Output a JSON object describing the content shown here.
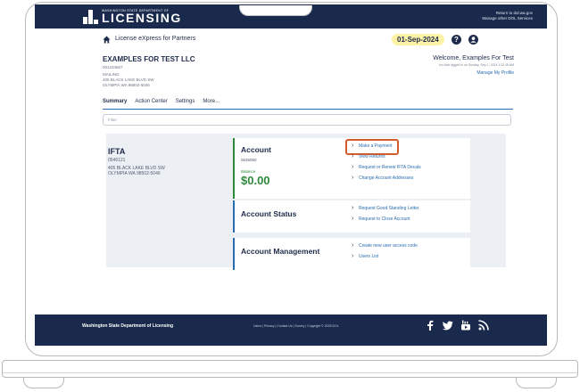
{
  "topbar": {
    "logo_small": "WASHINGTON STATE DEPARTMENT OF",
    "logo_big": "LICENSING",
    "link_return": "Return to dol.wa.gov",
    "link_manage": "Manage other DOL Services"
  },
  "header": {
    "title": "License eXpress for Partners",
    "date": "01-Sep-2024"
  },
  "account": {
    "name": "EXAMPLES FOR TEST LLC",
    "number": "001234567",
    "mailing_label": "MAILING",
    "address1": "405 BLACK LAKE BLVD SW",
    "address2": "OLYMPIA WA 98502-5046"
  },
  "welcome": {
    "title": "Welcome, Examples For Test",
    "sub": "You last logged in on Sunday, Sep 1, 2024 1:22:15 AM",
    "manage": "Manage My Profile"
  },
  "tabs": [
    "Summary",
    "Action Center",
    "Settings",
    "More..."
  ],
  "filter_placeholder": "Filter",
  "ifta": {
    "title": "IFTA",
    "number": "0546121",
    "address1": "405 BLACK LAKE BLVD SW",
    "address2": "OLYMPIA WA 98502-5046"
  },
  "card_account": {
    "title": "Account",
    "number": "0635050",
    "balance_label": "Balance",
    "balance": "$0.00",
    "links": [
      "Make a Payment",
      "View Returns",
      "Request or Renew IFTA Decals",
      "Change Account Addresses"
    ]
  },
  "card_status": {
    "title": "Account Status",
    "links": [
      "Request Good Standing Letter",
      "Request to Close Account"
    ]
  },
  "card_management": {
    "title": "Account Management",
    "links": [
      "Create new user access code",
      "Users List"
    ]
  },
  "footer": {
    "org": "Washington State Department of Licensing",
    "links": "Users | Privacy | Contact Us | Survey | Copyright © 2025 DOL"
  },
  "colors": {
    "navy": "#1a2a4c",
    "link_blue": "#2a6cb0",
    "balance_green": "#2e8a3a",
    "highlight_orange": "#d35a2a",
    "date_badge": "#fdf3a6"
  }
}
